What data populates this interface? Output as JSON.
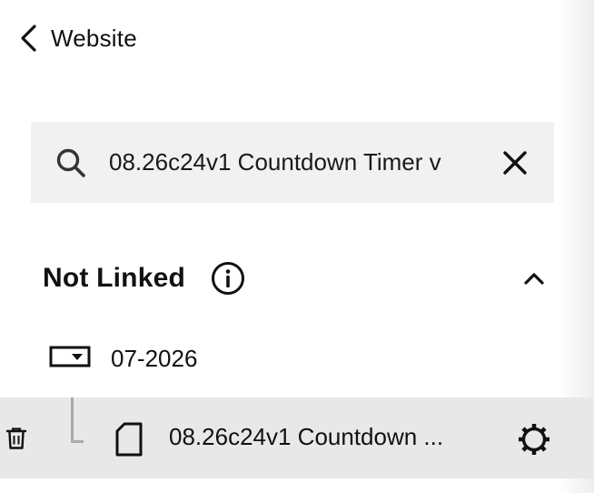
{
  "header": {
    "back_label": "Website"
  },
  "search": {
    "value": "08.26c24v1 Countdown Timer v"
  },
  "section": {
    "title": "Not Linked"
  },
  "folder": {
    "label": "07-2026"
  },
  "page": {
    "label": "08.26c24v1 Countdown ..."
  },
  "icons": {
    "back": "chevron-left-icon",
    "search": "search-icon",
    "clear": "close-icon",
    "info": "info-icon",
    "collapse": "chevron-up-icon",
    "folder": "folder-dropdown-icon",
    "trash": "trash-icon",
    "page": "page-icon",
    "settings": "gear-icon"
  }
}
